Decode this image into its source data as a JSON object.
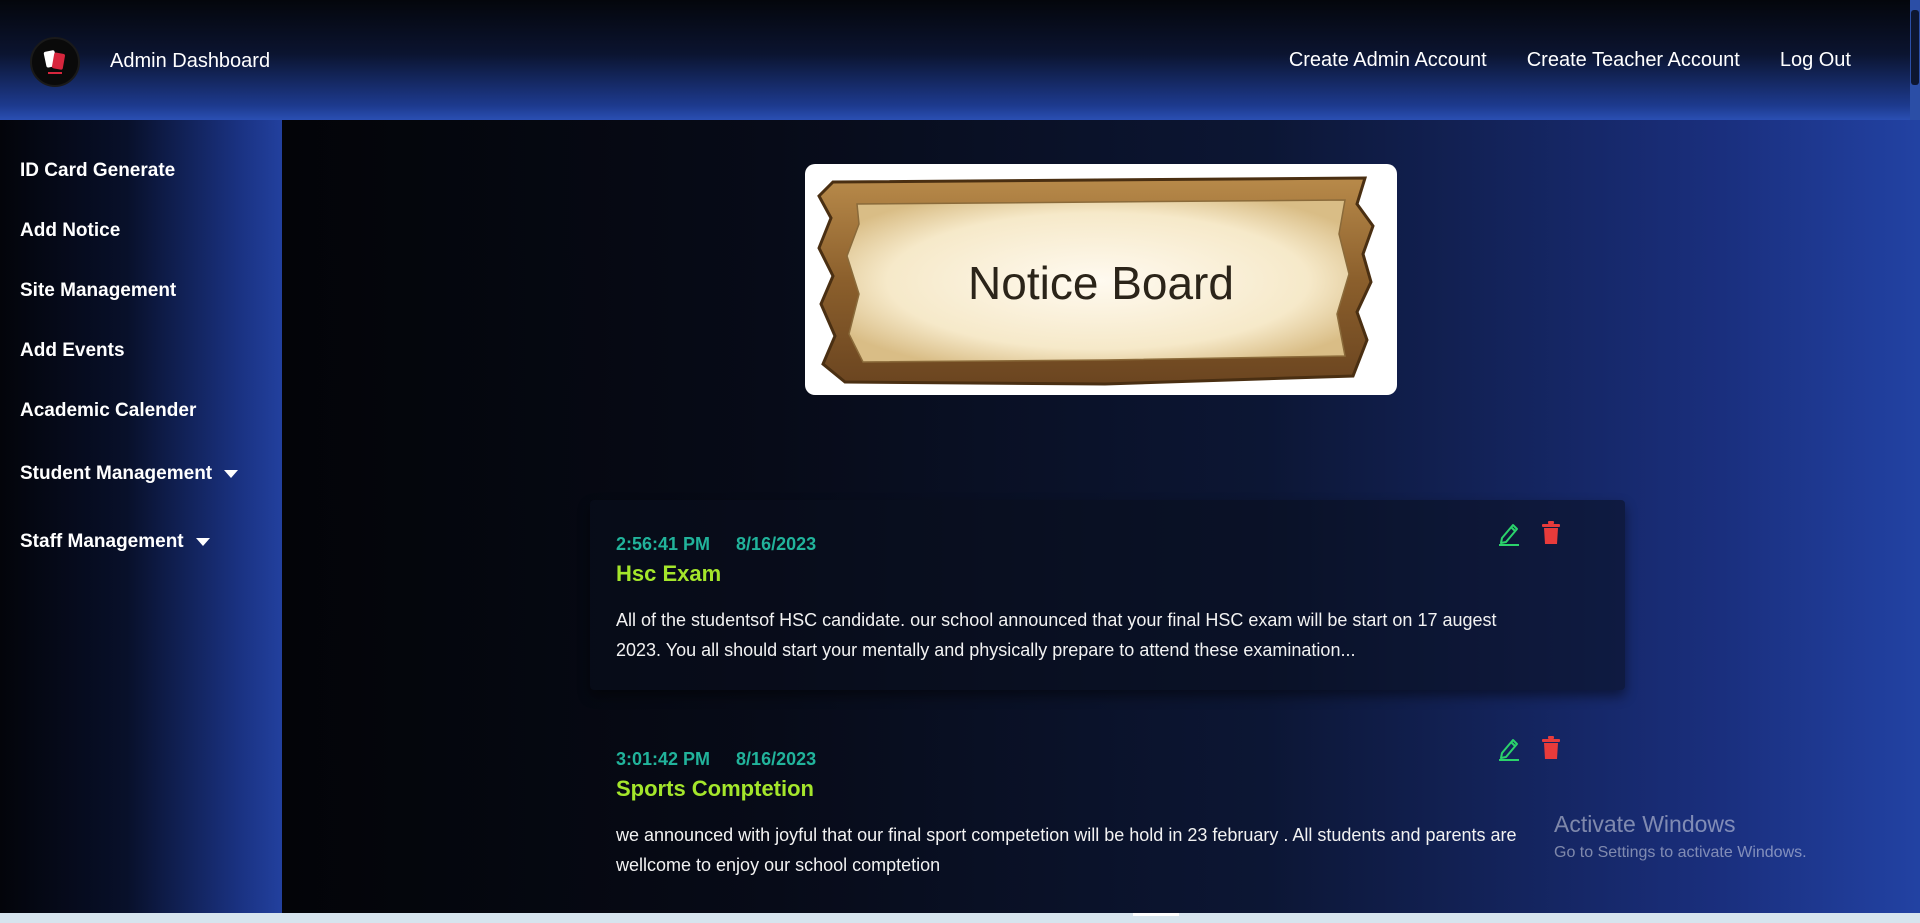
{
  "app": {
    "title": "Admin Dashboard"
  },
  "topnav": {
    "items": [
      {
        "label": "Create Admin Account"
      },
      {
        "label": "Create Teacher Account"
      },
      {
        "label": "Log Out"
      }
    ]
  },
  "sidebar": {
    "items": [
      {
        "label": "ID Card Generate"
      },
      {
        "label": "Add Notice"
      },
      {
        "label": "Site Management"
      },
      {
        "label": "Add Events"
      },
      {
        "label": "Academic Calender"
      },
      {
        "label": "Student Management",
        "has_dropdown": true
      },
      {
        "label": "Staff Management",
        "has_dropdown": true
      }
    ]
  },
  "banner": {
    "text": "Notice Board"
  },
  "notices": [
    {
      "time": "2:56:41 PM",
      "date": "8/16/2023",
      "title": "Hsc Exam",
      "body": "All of the studentsof HSC candidate. our school announced that your final HSC exam will be start on 17 augest 2023. You all should start your mentally and physically prepare to attend these examination..."
    },
    {
      "time": "3:01:42 PM",
      "date": "8/16/2023",
      "title": "Sports Comptetion",
      "body": "we announced with joyful that our final sport competetion will be hold in 23 february . All students and parents are wellcome to enjoy our school comptetion"
    }
  ],
  "watermark": {
    "line1": "Activate Windows",
    "line2": "Go to Settings to activate Windows."
  },
  "colors": {
    "accent_time": "#21b39b",
    "accent_title": "#a4e62b",
    "edit_icon": "#2bd36b",
    "delete_icon": "#e83b3b"
  }
}
